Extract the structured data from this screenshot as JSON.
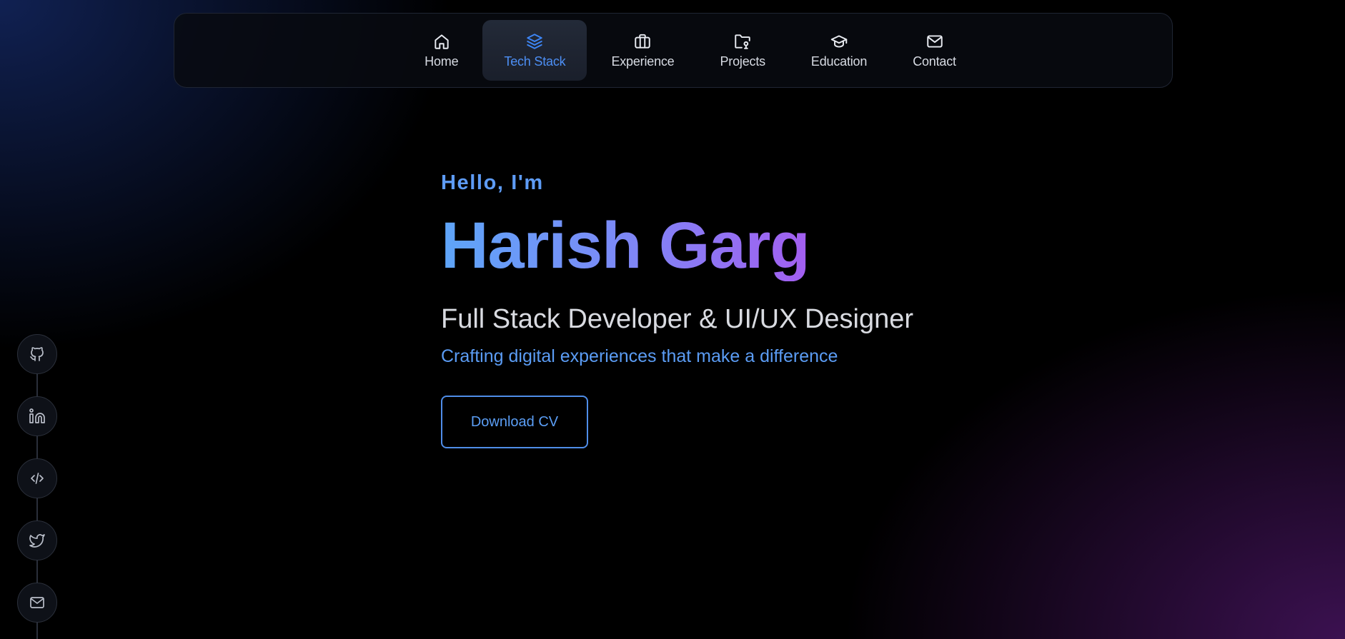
{
  "nav": {
    "items": [
      {
        "label": "Home",
        "icon": "home-icon",
        "active": false
      },
      {
        "label": "Tech Stack",
        "icon": "layers-icon",
        "active": true
      },
      {
        "label": "Experience",
        "icon": "briefcase-icon",
        "active": false
      },
      {
        "label": "Projects",
        "icon": "folder-code-icon",
        "active": false
      },
      {
        "label": "Education",
        "icon": "graduation-cap-icon",
        "active": false
      },
      {
        "label": "Contact",
        "icon": "mail-icon",
        "active": false
      }
    ]
  },
  "hero": {
    "greeting": "Hello, I'm",
    "name": "Harish Garg",
    "role": "Full Stack Developer & UI/UX Designer",
    "tagline": "Crafting digital experiences that make a difference",
    "cv_button": "Download CV"
  },
  "social": {
    "links": [
      "github-icon",
      "linkedin-icon",
      "code-icon",
      "twitter-icon",
      "mail-icon"
    ]
  },
  "colors": {
    "accent_blue": "#5b9cf4",
    "accent_purple": "#a35ef0",
    "active_nav_text": "#4d8ff5",
    "background": "#000000"
  }
}
